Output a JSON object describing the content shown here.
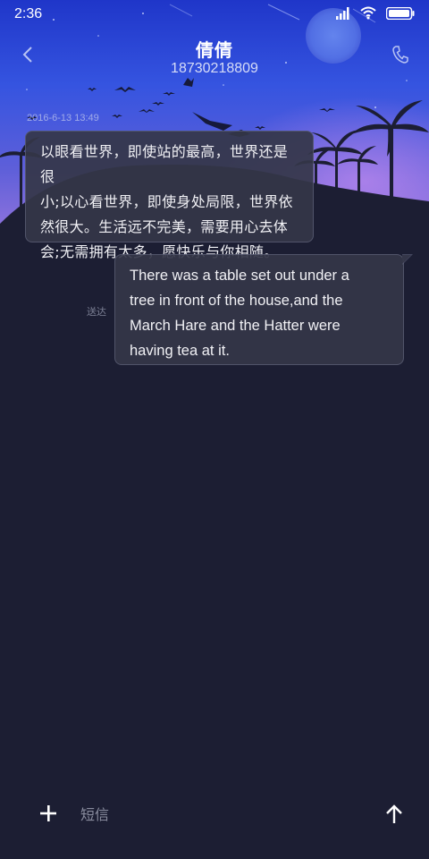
{
  "status_bar": {
    "time": "2:36",
    "icons": [
      "signal-icon",
      "wifi-icon",
      "battery-icon"
    ]
  },
  "header": {
    "contact_name": "倩倩",
    "contact_number": "18730218809",
    "back_icon": "chevron-left-icon",
    "call_icon": "phone-icon"
  },
  "conversation": {
    "timestamp": "2016-6-13 13:49",
    "messages": [
      {
        "direction": "incoming",
        "lines": [
          "以眼看世界，即使站的最高，世界还是很",
          "小;以心看世界，即使身处局限，世界依",
          "然很大。生活远不完美，需要用心去体",
          "会;无需拥有太多，愿快乐与你相随。"
        ]
      },
      {
        "direction": "outgoing",
        "lines": [
          "There was a table set out under a",
          "tree in front of the house,and the",
          "March Hare and the Hatter were",
          "having tea at it."
        ],
        "status": "送达"
      }
    ]
  },
  "composer": {
    "placeholder": "短信",
    "add_icon": "plus-icon",
    "send_icon": "arrow-up-icon"
  },
  "colors": {
    "background": "#1c1e33",
    "bubble": "#343648",
    "sky_top": "#2f4ad8",
    "sky_bottom": "#8a6fd8"
  }
}
